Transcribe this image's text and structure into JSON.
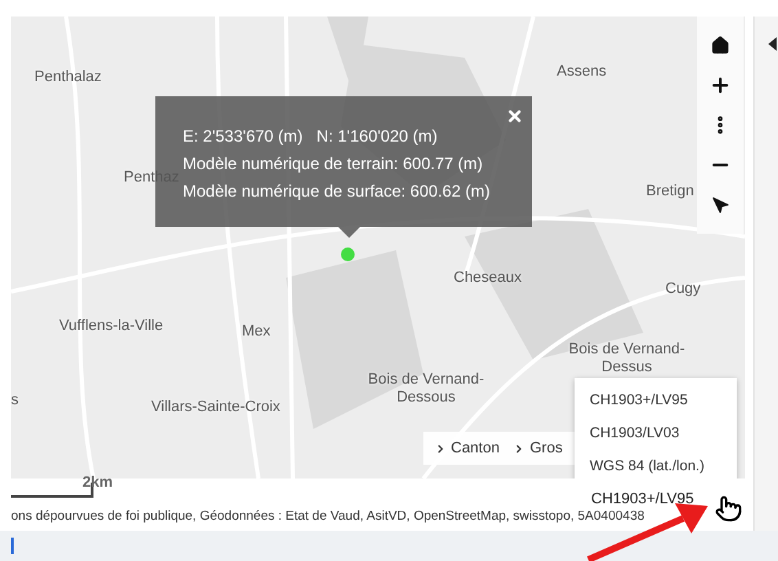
{
  "map": {
    "place_labels": [
      {
        "text": "Penthalaz"
      },
      {
        "text": "Assens"
      },
      {
        "text": "Penthaz"
      },
      {
        "text": "Bretign"
      },
      {
        "text": "Cheseaux"
      },
      {
        "text": "Cugy"
      },
      {
        "text": "Vufflens-la-Ville"
      },
      {
        "text": "Mex"
      },
      {
        "text": "Bois de Vernand-Dessus"
      },
      {
        "text": "s"
      },
      {
        "text": "Villars-Sainte-Croix"
      },
      {
        "text": "Bois de Vernand-Dessous"
      }
    ],
    "popup": {
      "easting": "E: 2'533'670 (m)",
      "northing": "N: 1'160'020 (m)",
      "lines": [
        "Modèle numérique de terrain: 600.77 (m)",
        "Modèle numérique de surface: 600.62 (m)"
      ]
    },
    "breadcrumbs": [
      "Canton",
      "Gros"
    ],
    "scale": "2km",
    "projection": {
      "value": "CH1903+/LV95",
      "expanded": true,
      "options": [
        "CH1903+/LV95",
        "CH1903/LV03",
        "WGS 84 (lat./lon.)"
      ]
    },
    "attribution": "ons dépourvues de foi publique, Géodonnées : Etat de Vaud, AsitVD, OpenStreetMap, swisstopo, 5A0400438"
  }
}
